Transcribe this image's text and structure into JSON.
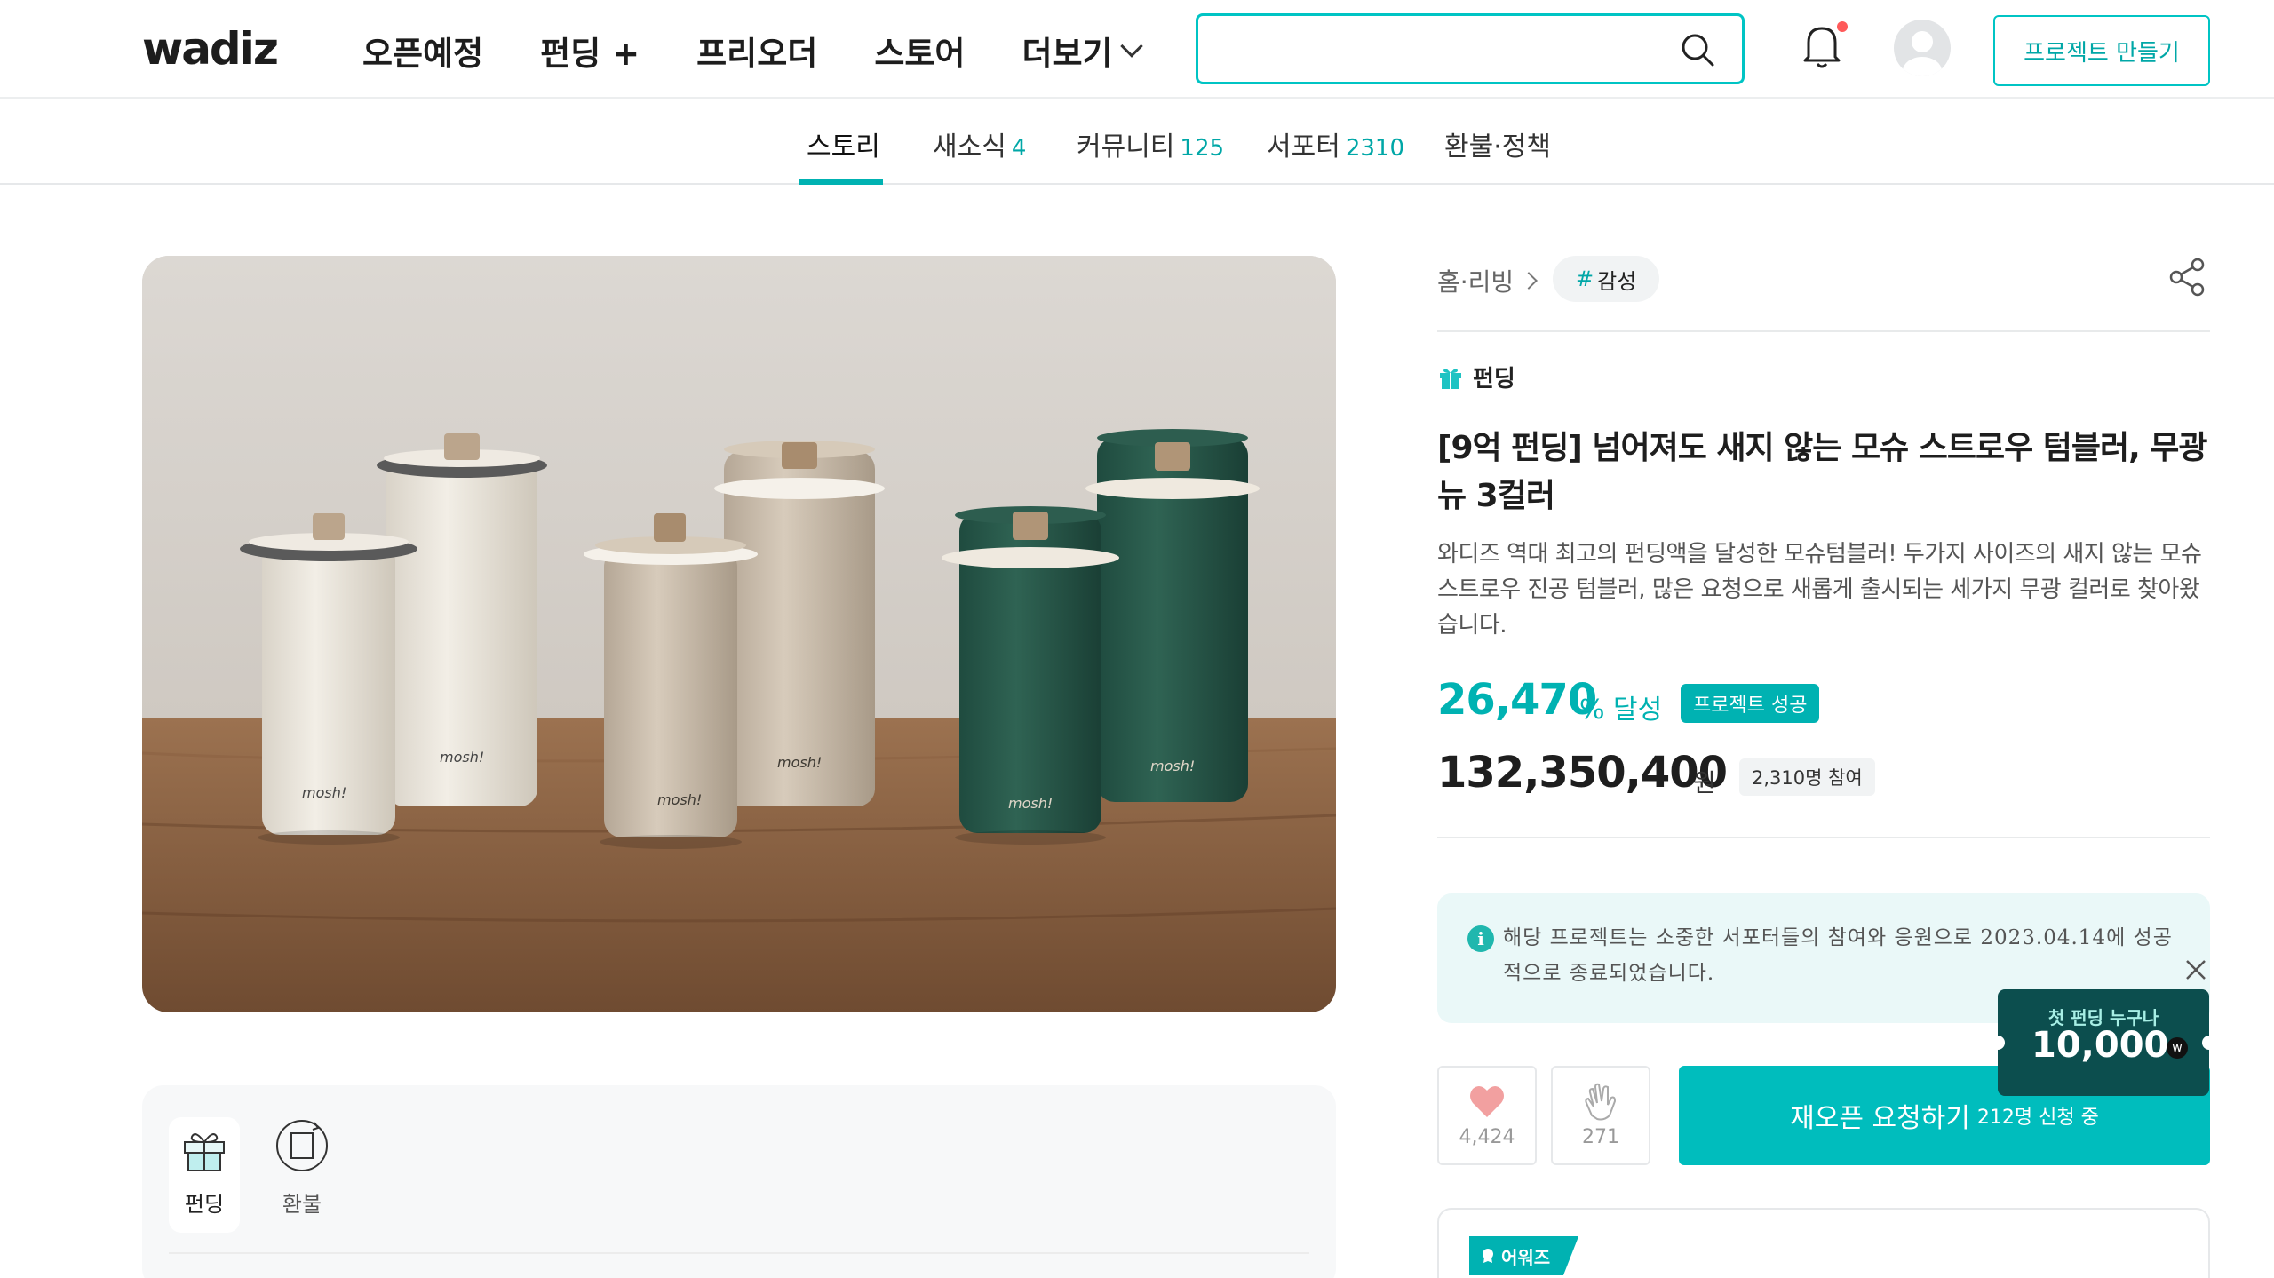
{
  "header": {
    "logo": "wadiz",
    "nav": [
      "오픈예정",
      "펀딩 +",
      "프리오더",
      "스토어",
      "더보기"
    ],
    "search_value": "",
    "make_project_label": "프로젝트 만들기"
  },
  "tabs": [
    {
      "label": "스토리",
      "count": ""
    },
    {
      "label": "새소식",
      "count": "4"
    },
    {
      "label": "커뮤니티",
      "count": "125"
    },
    {
      "label": "서포터",
      "count": "2310"
    },
    {
      "label": "환불·정책",
      "count": ""
    }
  ],
  "info_panel": {
    "items": [
      "펀딩",
      "환불"
    ]
  },
  "project": {
    "category": "홈·리빙",
    "tag_hash": "#",
    "tag": "감성",
    "kind": "펀딩",
    "title": "[9억 펀딩] 넘어져도 새지 않는 모슈 스트로우 텀블러, 무광 뉴 3컬러",
    "description": "와디즈 역대 최고의 펀딩액을 달성한 모슈텀블러! 두가지 사이즈의 새지 않는 모슈 스트로우 진공 텀블러, 많은 요청으로 새롭게 출시되는 세가지 무광 컬러로 찾아왔습니다.",
    "percent": "26,470",
    "percent_unit": "% 달성",
    "success_badge": "프로젝트 성공",
    "amount": "132,350,400",
    "amount_unit": "원",
    "supporters": "2,310명 참여"
  },
  "notice": {
    "text": "해당 프로젝트는 소중한 서포터들의 참여와 응원으로 2023.04.14에 성공적으로 종료되었습니다."
  },
  "coupon": {
    "top": "첫 펀딩 누구나",
    "amount": "10,000",
    "currency": "w"
  },
  "actions": {
    "likes": "4,424",
    "cheers": "271",
    "reopen_label": "재오픈 요청하기",
    "reopen_count": "212명 신청 중"
  },
  "award": {
    "tag": "어워즈"
  },
  "colors": {
    "accent": "#00c4c4",
    "accent_dark": "#00b2b2",
    "notice_bg": "#eaf8f8",
    "coupon_bg": "#0c4e4e"
  },
  "product_image": {
    "brand_on_tumbler": "mosh!"
  }
}
